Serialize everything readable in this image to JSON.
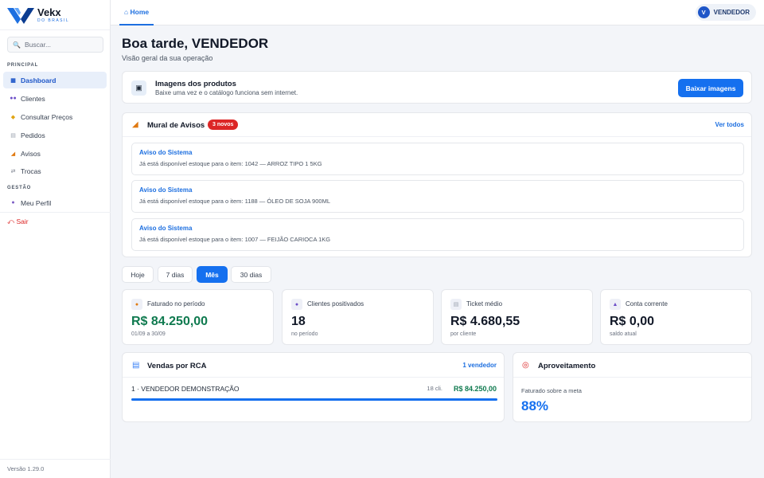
{
  "brand": {
    "name": "Vekx",
    "sub": "DO BRASIL"
  },
  "search": {
    "placeholder": "Buscar..."
  },
  "sidebar": {
    "section_principal": "PRINCIPAL",
    "section_gestao": "GESTÃO",
    "items": [
      {
        "label": "Dashboard",
        "icon": "dashboard-icon",
        "active": true
      },
      {
        "label": "Clientes",
        "icon": "users-icon"
      },
      {
        "label": "Consultar Preços",
        "icon": "price-tag-icon"
      },
      {
        "label": "Pedidos",
        "icon": "orders-icon"
      },
      {
        "label": "Avisos",
        "icon": "megaphone-icon"
      },
      {
        "label": "Trocas",
        "icon": "exchange-icon"
      },
      {
        "label": "Meu Perfil",
        "icon": "profile-icon"
      }
    ],
    "logout": "Sair",
    "version": "Versão 1.29.0"
  },
  "topbar": {
    "home_tab": "Home",
    "user_initial": "V",
    "user_name": "VENDEDOR"
  },
  "greeting": {
    "title": "Boa tarde, VENDEDOR",
    "subtitle": "Visão geral da sua operação"
  },
  "images_card": {
    "title": "Imagens dos produtos",
    "subtitle": "Baixe uma vez e o catálogo funciona sem internet.",
    "button": "Baixar imagens"
  },
  "mural": {
    "title": "Mural de Avisos",
    "badge": "3 novos",
    "see_all": "Ver todos",
    "notices": [
      {
        "title": "Aviso do Sistema",
        "text": "Já está disponível estoque para o item: 1042 — ARROZ TIPO 1 5KG"
      },
      {
        "title": "Aviso do Sistema",
        "text": "Já está disponível estoque para o item: 1188 — ÓLEO DE SOJA 900ML"
      },
      {
        "title": "Aviso do Sistema",
        "text": "Já está disponível estoque para o item: 1007 — FEIJÃO CARIOCA 1KG"
      }
    ]
  },
  "periods": {
    "today": "Hoje",
    "week": "7 dias",
    "month": "Mês",
    "thirty": "30 dias",
    "active": "Mês"
  },
  "kpis": [
    {
      "label": "Faturado no período",
      "value": "R$ 84.250,00",
      "sub": "01/09 a 30/09",
      "icon": "money-bag-icon"
    },
    {
      "label": "Clientes positivados",
      "value": "18",
      "sub": "no período",
      "icon": "users-icon"
    },
    {
      "label": "Ticket médio",
      "value": "R$ 4.680,55",
      "sub": "por cliente",
      "icon": "receipt-icon"
    },
    {
      "label": "Conta corrente",
      "value": "R$ 0,00",
      "sub": "saldo atual",
      "icon": "bank-icon"
    }
  ],
  "vendas": {
    "title": "Vendas por RCA",
    "link": "1 vendedor",
    "row": {
      "name": "1 · VENDEDOR DEMONSTRAÇÃO",
      "clients": "18 cli.",
      "value": "R$ 84.250,00",
      "share": 1.0
    }
  },
  "aproveitamento": {
    "title": "Aproveitamento",
    "label": "Faturado sobre a meta",
    "value": "88%"
  },
  "colors": {
    "accent": "#1570ef",
    "green": "#0f7a4f",
    "danger": "#dc2626"
  }
}
